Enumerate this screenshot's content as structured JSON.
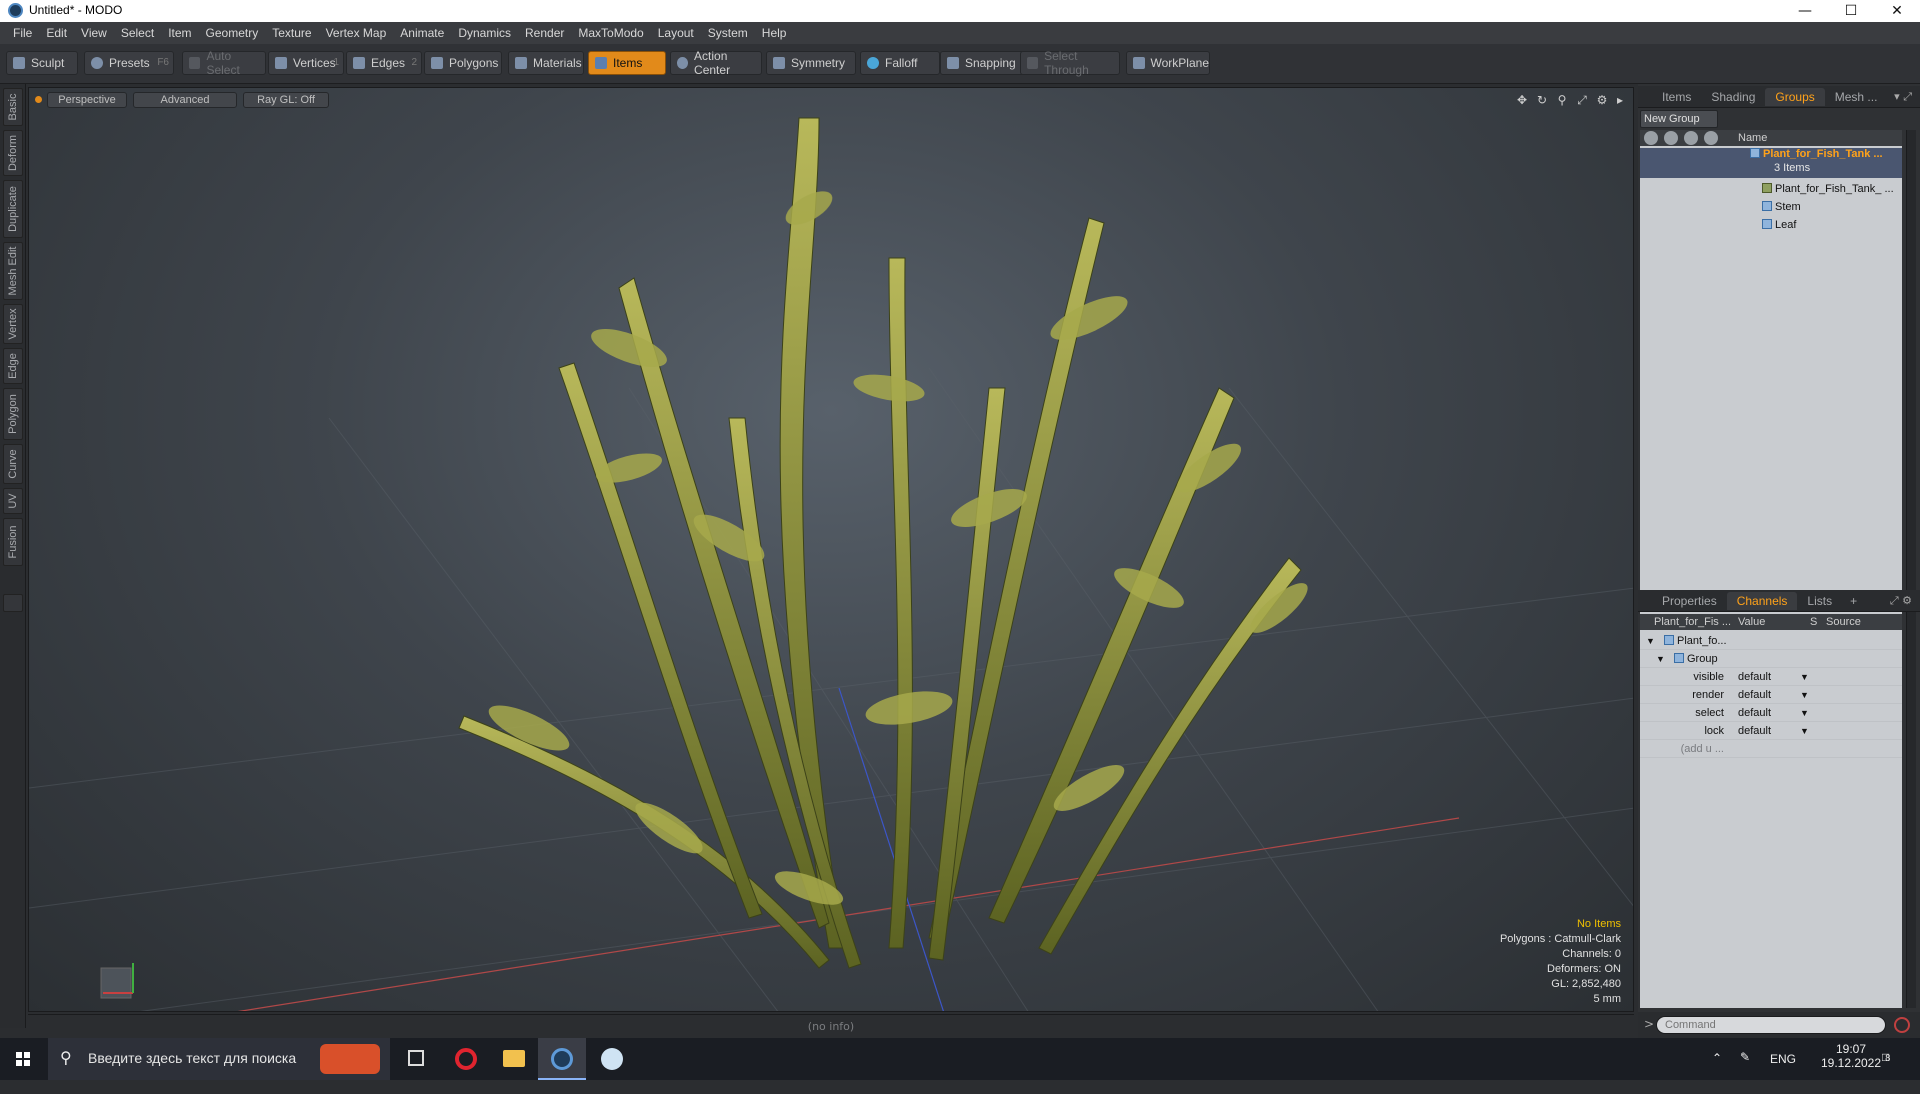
{
  "window": {
    "title": "Untitled* - MODO"
  },
  "menu": [
    "File",
    "Edit",
    "View",
    "Select",
    "Item",
    "Geometry",
    "Texture",
    "Vertex Map",
    "Animate",
    "Dynamics",
    "Render",
    "MaxToModo",
    "Layout",
    "System",
    "Help"
  ],
  "toolbar": {
    "sculpt": "Sculpt",
    "presets": "Presets",
    "presets_key": "F6",
    "auto_select": "Auto Select",
    "vertices": "Vertices",
    "vertices_key": "1",
    "edges": "Edges",
    "edges_key": "2",
    "polygons": "Polygons",
    "materials": "Materials",
    "items": "Items",
    "action_center": "Action Center",
    "symmetry": "Symmetry",
    "falloff": "Falloff",
    "snapping": "Snapping",
    "select_through": "Select Through",
    "workplane": "WorkPlane"
  },
  "left_tabs": [
    "Basic",
    "Deform",
    "Duplicate",
    "Mesh Edit",
    "Vertex",
    "Edge",
    "Polygon",
    "Curve",
    "UV",
    "Fusion"
  ],
  "viewport": {
    "perspective": "Perspective",
    "advanced": "Advanced",
    "raygl": "Ray GL: Off",
    "info": {
      "no_items": "No Items",
      "polygons": "Polygons : Catmull-Clark",
      "channels": "Channels: 0",
      "deformers": "Deformers: ON",
      "gl": "GL: 2,852,480",
      "scale": "5 mm"
    }
  },
  "status": {
    "text": "(no info)"
  },
  "groups_panel": {
    "tabs": [
      "Items",
      "Shading",
      "Groups",
      "Mesh ..."
    ],
    "active_tab": "Groups",
    "new_group": "New Group",
    "name_header": "Name",
    "root": {
      "name": "Plant_for_Fish_Tank ...",
      "count": "3 Items"
    },
    "children": [
      "Plant_for_Fish_Tank_ ...",
      "Stem",
      "Leaf"
    ]
  },
  "channels_panel": {
    "tabs": [
      "Properties",
      "Channels",
      "Lists",
      "+"
    ],
    "active_tab": "Channels",
    "headers": {
      "item": "Plant_for_Fis ...",
      "value": "Value",
      "s": "S",
      "source": "Source"
    },
    "root": "Plant_fo...",
    "group": "Group",
    "rows": [
      {
        "label": "visible",
        "value": "default"
      },
      {
        "label": "render",
        "value": "default"
      },
      {
        "label": "select",
        "value": "default"
      },
      {
        "label": "lock",
        "value": "default"
      }
    ],
    "add_user": "(add u ..."
  },
  "command": {
    "placeholder": "Command"
  },
  "taskbar": {
    "search_placeholder": "Введите здесь текст для поиска",
    "lang": "ENG",
    "time": "19:07",
    "date": "19.12.2022",
    "notifications": "8"
  },
  "colors": {
    "accent": "#e28a1a",
    "selected_text": "#ffa21a",
    "info_highlight": "#f0c000"
  }
}
